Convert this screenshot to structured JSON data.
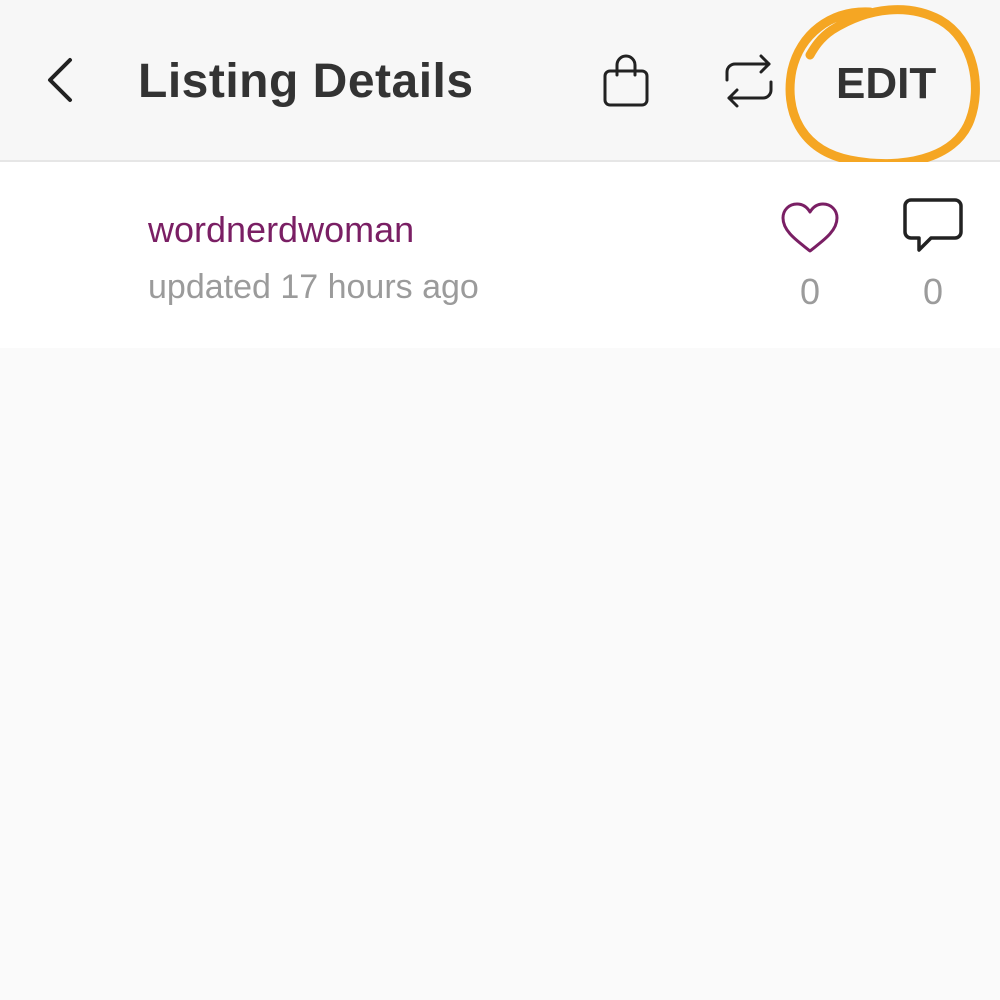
{
  "header": {
    "title": "Listing Details",
    "edit_label": "EDIT",
    "icons": {
      "back": "chevron-left-icon",
      "bag": "shopping-bag-icon",
      "share": "repost-icon"
    },
    "highlight_color": "#f5a623"
  },
  "listing": {
    "username": "wordnerdwoman",
    "updated": "updated 17 hours ago",
    "likes": "0",
    "comments": "0",
    "icons": {
      "like": "heart-icon",
      "comment": "comment-icon"
    },
    "username_color": "#7a1f64"
  }
}
